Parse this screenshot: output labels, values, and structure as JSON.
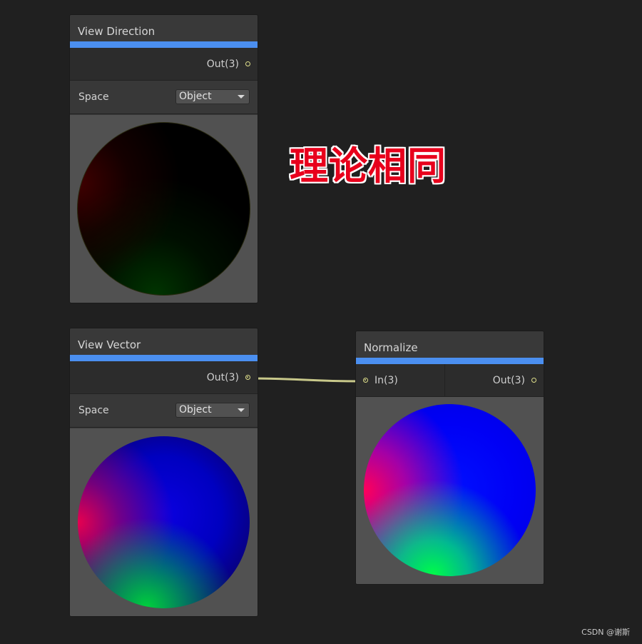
{
  "annotation": "理论相同",
  "watermark": "CSDN @谢斯",
  "colors": {
    "accent_bar": "#4b8ff0",
    "port": "#dede8a",
    "annotation_text": "#e8001c"
  },
  "nodes": {
    "view_direction": {
      "title": "View Direction",
      "output_label": "Out(3)",
      "space_label": "Space",
      "space_value": "Object"
    },
    "view_vector": {
      "title": "View Vector",
      "output_label": "Out(3)",
      "space_label": "Space",
      "space_value": "Object"
    },
    "normalize": {
      "title": "Normalize",
      "input_label": "In(3)",
      "output_label": "Out(3)"
    }
  }
}
